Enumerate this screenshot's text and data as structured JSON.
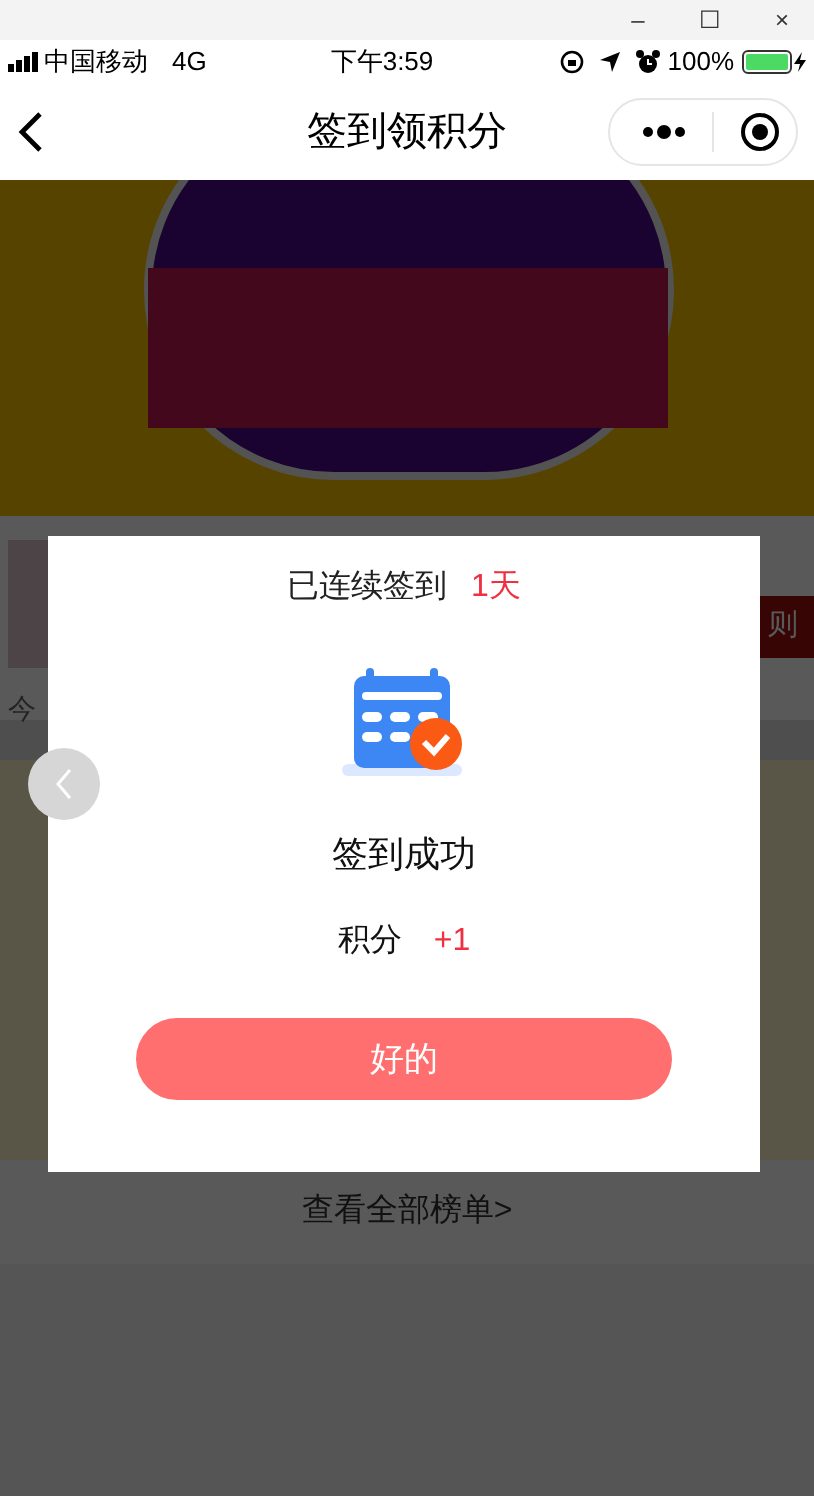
{
  "window_controls": [
    "–",
    "☐",
    "×"
  ],
  "status_bar": {
    "carrier": "中国移动",
    "network": "4G",
    "time": "下午3:59",
    "battery": "100%"
  },
  "nav": {
    "title": "签到领积分"
  },
  "background": {
    "fragment_left": "今",
    "fragment_right": "则",
    "link": "查看全部榜单>"
  },
  "dialog": {
    "streak_label": "已连续签到",
    "streak_value": "1天",
    "message": "签到成功",
    "points_label": "积分",
    "points_value": "+1",
    "button": "好的"
  }
}
